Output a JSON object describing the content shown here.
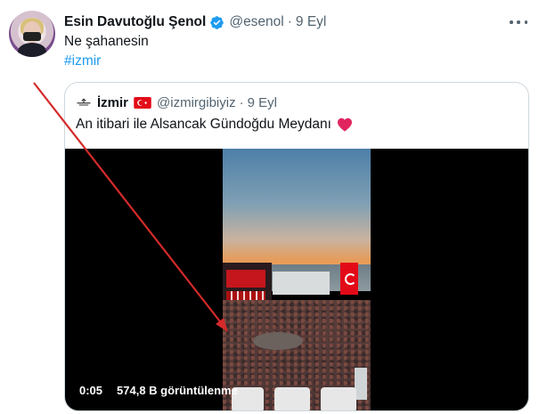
{
  "tweet": {
    "author_name": "Esin Davutoğlu Şenol",
    "handle": "@esenol",
    "separator": "·",
    "date": "9 Eyl",
    "text": "Ne şahanesin",
    "hashtag": "#izmir",
    "verified": true
  },
  "quoted_tweet": {
    "author_name": "İzmir",
    "handle": "@izmirgibiyiz",
    "separator": "·",
    "date": "9 Eyl",
    "text": "An itibari ile Alsancak Gündoğdu Meydanı",
    "emoji": "red-heart",
    "flag": "turkey-flag"
  },
  "video": {
    "duration": "0:05",
    "views": "574,8 B görüntülenme"
  },
  "annotation": {
    "type": "arrow",
    "color": "#d42a2a"
  },
  "colors": {
    "link": "#1d9bf0",
    "secondary_text": "#536471",
    "verified_badge": "#1d9bf0",
    "heart": "#e0245e"
  }
}
